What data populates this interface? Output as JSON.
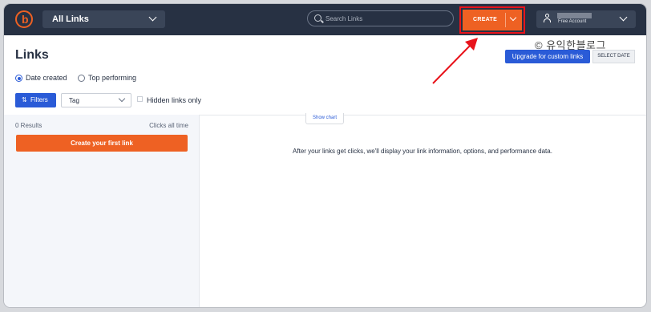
{
  "header": {
    "logo_letter": "b",
    "link_filter": "All Links",
    "search_placeholder": "Search Links",
    "create_label": "CREATE",
    "account_plan": "Free Account"
  },
  "page": {
    "title": "Links",
    "watermark": "© 유익한블로그",
    "upgrade_label": "Upgrade for custom links",
    "select_date_label": "SELECT DATE"
  },
  "sort": {
    "options": [
      "Date created",
      "Top performing"
    ],
    "selected": "Date created"
  },
  "filters": {
    "filters_icon": "⇅",
    "filters_label": "Filters",
    "tag_label": "Tag",
    "hidden_label": "Hidden links only",
    "hidden_checked": false
  },
  "sidebar": {
    "results": "0 Results",
    "clicks": "Clicks all time",
    "first_link_label": "Create your first link"
  },
  "main": {
    "show_chart": "Show chart",
    "empty_message": "After your links get clicks, we'll display your link information, options, and performance data."
  },
  "colors": {
    "nav": "#273143",
    "orange": "#ee6123",
    "blue": "#2a5bd7",
    "highlight_red": "#e8131b"
  }
}
